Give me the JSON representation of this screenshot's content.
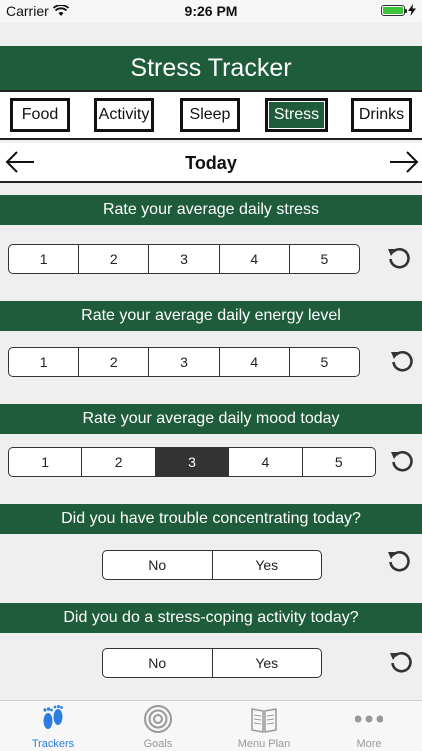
{
  "status": {
    "carrier": "Carrier",
    "time": "9:26 PM"
  },
  "header": {
    "title": "Stress Tracker"
  },
  "categories": [
    {
      "label": "Food",
      "active": false
    },
    {
      "label": "Activity",
      "active": false
    },
    {
      "label": "Sleep",
      "active": false
    },
    {
      "label": "Stress",
      "active": true
    },
    {
      "label": "Drinks",
      "active": false
    }
  ],
  "day": {
    "label": "Today"
  },
  "questions": [
    {
      "title": "Rate your average daily stress",
      "options": [
        "1",
        "2",
        "3",
        "4",
        "5"
      ],
      "selected": null
    },
    {
      "title": "Rate your average daily energy level",
      "options": [
        "1",
        "2",
        "3",
        "4",
        "5"
      ],
      "selected": null
    },
    {
      "title": "Rate your average daily mood today",
      "options": [
        "1",
        "2",
        "3",
        "4",
        "5"
      ],
      "selected": "3"
    },
    {
      "title": "Did you have trouble concentrating today?",
      "options": [
        "No",
        "Yes"
      ],
      "selected": null
    },
    {
      "title": "Did you do a stress-coping activity today?",
      "options": [
        "No",
        "Yes"
      ],
      "selected": null
    }
  ],
  "tabs": [
    {
      "label": "Trackers",
      "icon": "footprints-icon",
      "active": true
    },
    {
      "label": "Goals",
      "icon": "target-icon",
      "active": false
    },
    {
      "label": "Menu Plan",
      "icon": "book-icon",
      "active": false
    },
    {
      "label": "More",
      "icon": "more-dots-icon",
      "active": false
    }
  ],
  "colors": {
    "brand_green": "#1e5c3b",
    "tab_active": "#2a7de1",
    "battery": "#3dc33d"
  }
}
